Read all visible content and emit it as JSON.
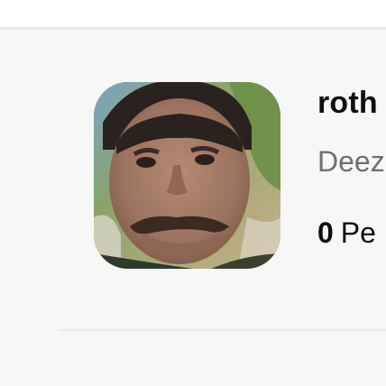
{
  "profile": {
    "name": "roth",
    "subtitle": "Deez",
    "fans_count": "0",
    "fans_label": "Pe",
    "avatar_icon": "profile-photo"
  },
  "colors": {
    "page_background": "#f6f7f6",
    "divider": "#e6e7e9",
    "name_text": "#0f0f12",
    "subtitle_text": "#6f6f78"
  }
}
